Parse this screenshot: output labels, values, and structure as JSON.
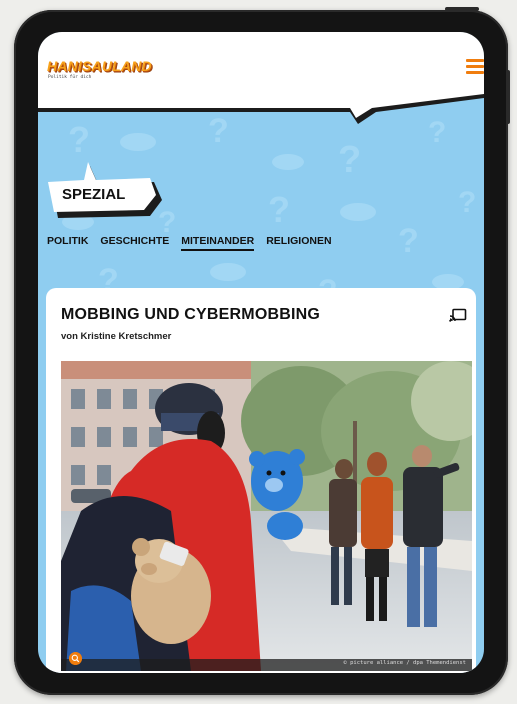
{
  "header": {
    "logo_text": "HANISAULAND",
    "tagline": "Politik für dich",
    "menu_icon": "hamburger-menu-icon"
  },
  "badge": {
    "label": "SPEZIAL"
  },
  "nav": {
    "items": [
      {
        "label": "POLITIK",
        "active": false
      },
      {
        "label": "GESCHICHTE",
        "active": false
      },
      {
        "label": "MITEINANDER",
        "active": true
      },
      {
        "label": "RELIGIONEN",
        "active": false
      }
    ]
  },
  "article": {
    "title": "MOBBING UND CYBERMOBBING",
    "author": "von Kristine Kretschmer",
    "image_credit": "© picture alliance / dpa Themendienst",
    "cast_icon": "cast-icon",
    "zoom_icon": "zoom-icon"
  },
  "colors": {
    "accent_orange": "#f07d0e",
    "logo_yellow": "#f7a21b",
    "sky_blue": "#8fcdf0",
    "text_dark": "#111111"
  }
}
